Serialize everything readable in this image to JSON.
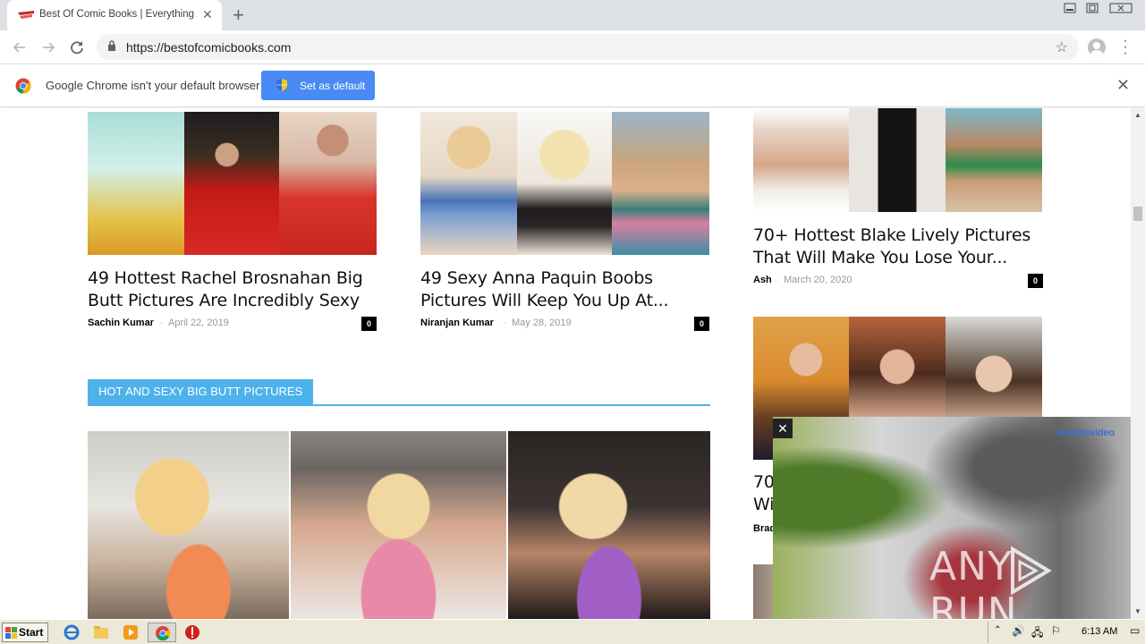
{
  "browser": {
    "tab_title": "Best Of Comic Books | Everything Ab",
    "url": "https://bestofcomicbooks.com",
    "infobar_text": "Google Chrome isn't your default browser",
    "set_default_label": "Set as default"
  },
  "articles": [
    {
      "title_line1": "49 Hottest Rachel Brosnahan Big",
      "title_line2": "Butt Pictures Are Incredibly Sexy",
      "author": "Sachin Kumar",
      "date": "April 22, 2019",
      "comments": "0"
    },
    {
      "title_line1": "49 Sexy Anna Paquin Boobs",
      "title_line2": "Pictures Will Keep You Up At...",
      "author": "Niranjan Kumar",
      "date": "May 28, 2019",
      "comments": "0"
    },
    {
      "title_line1": "70+ Hottest Blake Lively Pictures",
      "title_line2": "That Will Make You Lose Your...",
      "author": "Ash",
      "date": "March 20, 2020",
      "comments": "0"
    },
    {
      "title_line1": "70",
      "title_line2": "Wi",
      "author": "Brad"
    }
  ],
  "section": {
    "label": "HOT AND SEXY BIG BUTT PICTURES"
  },
  "video_ad": {
    "close_symbol": "✕",
    "brand": "avantisvideo",
    "watermark_left": "ANY",
    "watermark_right": "RUN"
  },
  "taskbar": {
    "start_label": "Start",
    "clock": "6:13 AM"
  },
  "colors": {
    "accent": "#4db2ec",
    "set_default_button": "#4a8af4"
  }
}
